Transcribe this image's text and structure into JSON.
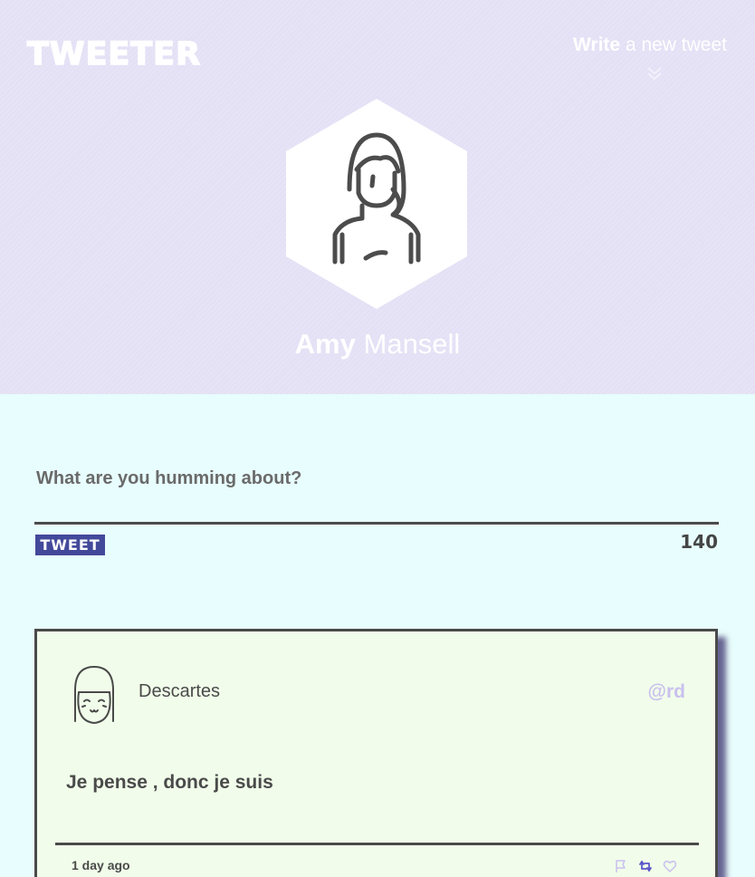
{
  "header": {
    "brand": "TWEETER",
    "compose_link_bold": "Write",
    "compose_link_rest": " a new tweet",
    "profile": {
      "first_name": "Amy",
      "last_name": "Mansell"
    }
  },
  "compose": {
    "prompt": "What are you humming about?",
    "submit_label": "TWEET",
    "counter": "140"
  },
  "tweets": [
    {
      "author": "Descartes",
      "handle": "@rd",
      "text": "Je pense , donc je suis",
      "time": "1 day ago",
      "actions": [
        "flag-icon",
        "retweet-icon",
        "heart-icon"
      ]
    }
  ],
  "colors": {
    "header_bg": "#e4e0f5",
    "page_bg": "#e8fdfd",
    "tweet_button": "#43499a",
    "handle": "#c9c0ee",
    "card_bg": "#f1fdea"
  }
}
